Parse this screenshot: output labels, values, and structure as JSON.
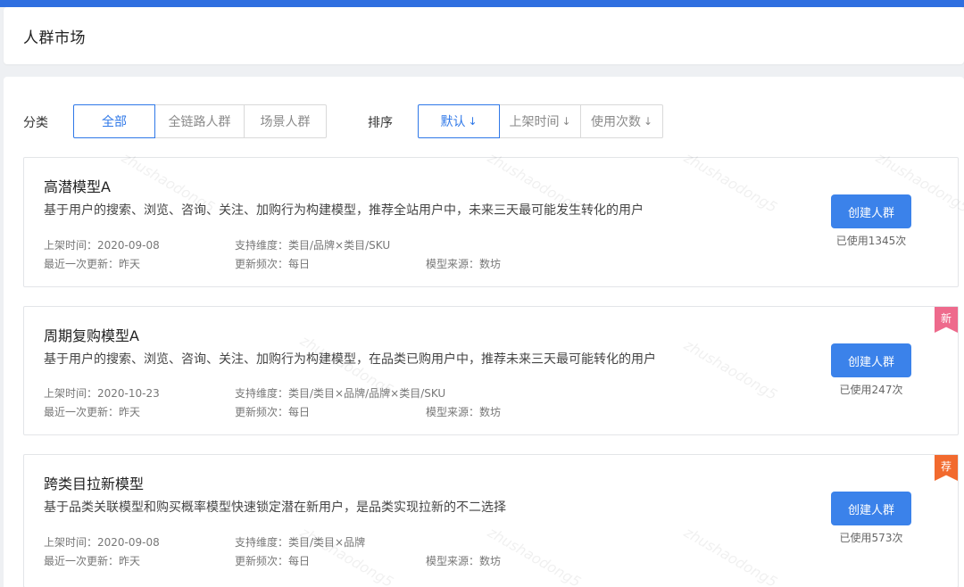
{
  "header": {
    "title": "人群市场"
  },
  "filters": {
    "category_label": "分类",
    "categories": [
      "全部",
      "全链路人群",
      "场景人群"
    ],
    "sort_label": "排序",
    "sorts": [
      "默认",
      "上架时间",
      "使用次数"
    ],
    "sort_arrow": "↓"
  },
  "meta_labels": {
    "listed": "上架时间：",
    "dimension": "支持维度：",
    "last_update": "最近一次更新：",
    "frequency": "更新频次：",
    "source": "模型来源："
  },
  "cards": [
    {
      "name": "高潜模型A",
      "desc": "基于用户的搜索、浏览、咨询、关注、加购行为构建模型，推荐全站用户中，未来三天最可能发生转化的用户",
      "listed": "2020-09-08",
      "dimension": "类目/品牌×类目/SKU",
      "last_update": "昨天",
      "frequency": "每日",
      "source": "数坊",
      "button": "创建人群",
      "usage": "已使用1345次",
      "badge": ""
    },
    {
      "name": "周期复购模型A",
      "desc": "基于用户的搜索、浏览、咨询、关注、加购行为构建模型，在品类已购用户中，推荐未来三天最可能转化的用户",
      "listed": "2020-10-23",
      "dimension": "类目/类目×品牌/品牌×类目/SKU",
      "last_update": "昨天",
      "frequency": "每日",
      "source": "数坊",
      "button": "创建人群",
      "usage": "已使用247次",
      "badge": "新"
    },
    {
      "name": "跨类目拉新模型",
      "desc": "基于品类关联模型和购买概率模型快速锁定潜在新用户，是品类实现拉新的不二选择",
      "listed": "2020-09-08",
      "dimension": "类目/类目×品牌",
      "last_update": "昨天",
      "frequency": "每日",
      "source": "数坊",
      "button": "创建人群",
      "usage": "已使用573次",
      "badge": "荐"
    }
  ],
  "colors": {
    "accent": "#2f78e8",
    "button": "#3b82ea",
    "badge_new": "#ee6a8c",
    "badge_recommend": "#f26a2e"
  },
  "watermark": "zhushaodong5"
}
